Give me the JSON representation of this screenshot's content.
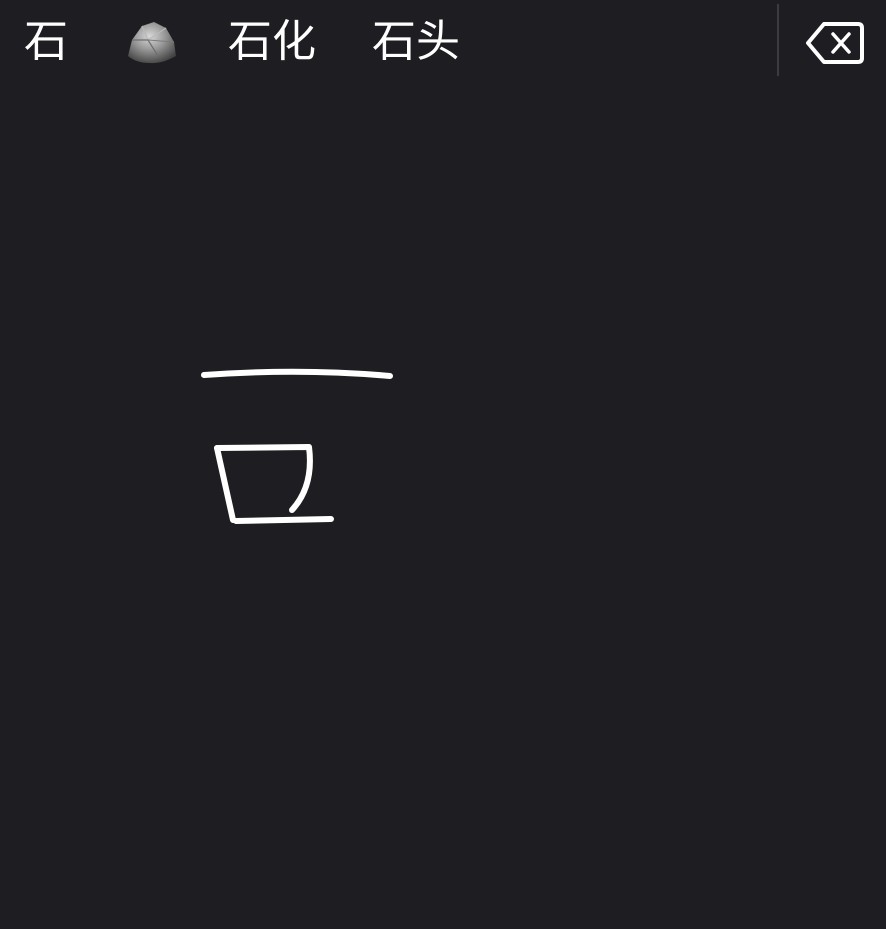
{
  "candidates": [
    {
      "label": "石"
    },
    {
      "label": "",
      "icon": "rock-emoji-icon"
    },
    {
      "label": "石化"
    },
    {
      "label": "石头"
    }
  ],
  "toolbar": {
    "delete_icon": "backspace-icon"
  },
  "colors": {
    "background": "#1e1d21",
    "text": "#ffffff",
    "divider": "#3c3b40",
    "stroke": "#ffffff"
  },
  "handwriting": {
    "strokes": 3
  }
}
